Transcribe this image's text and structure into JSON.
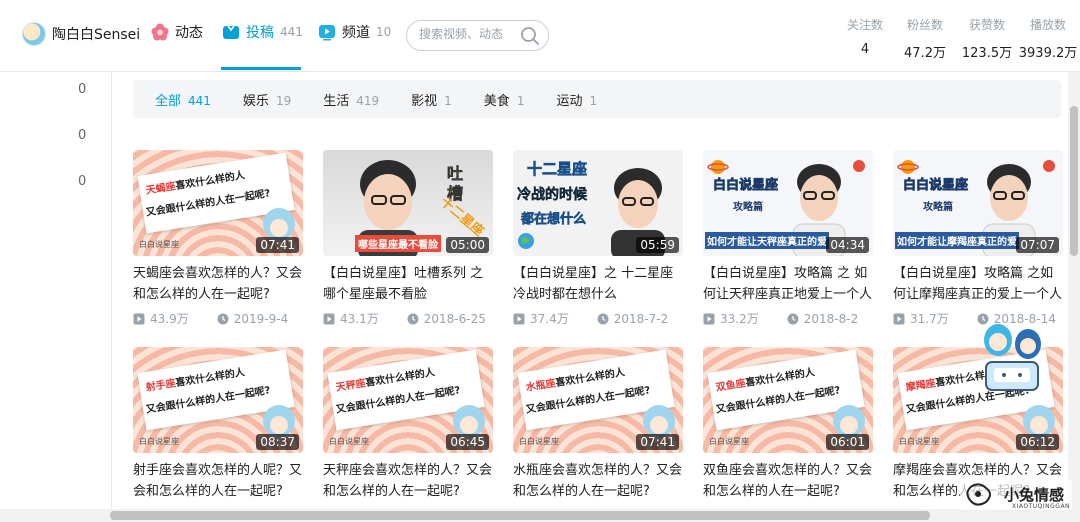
{
  "user": {
    "name": "陶白白Sensei"
  },
  "nav": [
    {
      "label": "动态",
      "count": ""
    },
    {
      "label": "投稿",
      "count": "441"
    },
    {
      "label": "频道",
      "count": "10"
    }
  ],
  "search": {
    "placeholder": "搜索视频、动态"
  },
  "stats": [
    {
      "label": "关注数",
      "value": "4"
    },
    {
      "label": "粉丝数",
      "value": "47.2万"
    },
    {
      "label": "获赞数",
      "value": "123.5万"
    },
    {
      "label": "播放数",
      "value": "3939.2万"
    }
  ],
  "left_counts": [
    "0",
    "0",
    "0"
  ],
  "filters": [
    {
      "label": "全部",
      "count": "441"
    },
    {
      "label": "娱乐",
      "count": "19"
    },
    {
      "label": "生活",
      "count": "419"
    },
    {
      "label": "影视",
      "count": "1"
    },
    {
      "label": "美食",
      "count": "1"
    },
    {
      "label": "运动",
      "count": "1"
    }
  ],
  "videos": [
    {
      "title": "天蝎座会喜欢怎样的人？又会和怎么样的人在一起呢?",
      "duration": "07:41",
      "plays": "43.9万",
      "date": "2019-9-4",
      "thumb": {
        "style": "quote",
        "hl": "天蝎座",
        "l1": "喜欢什么样的人",
        "l2": "又会跟什么样的人在一起呢?",
        "note": "白白说星座"
      }
    },
    {
      "title": "【白白说星座】吐槽系列 之 哪个星座最不看脸",
      "duration": "05:00",
      "plays": "43.1万",
      "date": "2018-6-25",
      "thumb": {
        "style": "face",
        "t1": "吐",
        "t2": "槽",
        "t3": "十二星座",
        "t4": "哪些星座最不看脸"
      }
    },
    {
      "title": "【白白说星座】之 十二星座冷战时都在想什么",
      "duration": "05:59",
      "plays": "37.4万",
      "date": "2018-7-2",
      "thumb": {
        "style": "cold",
        "t1": "十二星座",
        "t2": "冷战的时候",
        "t3": "都在想什么"
      }
    },
    {
      "title": "【白白说星座】攻略篇 之 如何让天秤座真正地爱上一个人",
      "duration": "04:34",
      "plays": "33.2万",
      "date": "2018-8-2",
      "thumb": {
        "style": "space",
        "t1": "白白说星座",
        "t2": "攻略篇",
        "t3": "如何才能让天秤座真正的爱"
      }
    },
    {
      "title": "【白白说星座】攻略篇 之如何让摩羯座真正的爱上一个人",
      "duration": "07:07",
      "plays": "31.7万",
      "date": "2018-8-14",
      "thumb": {
        "style": "space",
        "t1": "白白说星座",
        "t2": "攻略篇",
        "t3": "如何才能让摩羯座真正的爱"
      }
    },
    {
      "title": "射手座会喜欢怎样的人呢？又会和怎么样的人在一起呢?",
      "duration": "08:37",
      "plays": "",
      "date": "",
      "thumb": {
        "style": "quote",
        "hl": "射手座",
        "l1": "喜欢什么样的人",
        "l2": "又会跟什么样的人在一起呢?",
        "note": "白白说星座"
      }
    },
    {
      "title": "天秤座会喜欢怎样的人？又会和怎么样的人在一起呢?",
      "duration": "06:45",
      "plays": "",
      "date": "",
      "thumb": {
        "style": "quote",
        "hl": "天秤座",
        "l1": "喜欢什么样的人",
        "l2": "又会跟什么样的人在一起呢?",
        "note": "白白说星座"
      }
    },
    {
      "title": "水瓶座会喜欢怎样的人？又会和怎么样的人在一起呢?",
      "duration": "07:41",
      "plays": "",
      "date": "",
      "thumb": {
        "style": "quote",
        "hl": "水瓶座",
        "l1": "喜欢什么样的人",
        "l2": "又会跟什么样的人在一起呢?",
        "note": "白白说星座"
      }
    },
    {
      "title": "双鱼座会喜欢怎样的人？又会和怎么样的人在一起呢?",
      "duration": "06:01",
      "plays": "",
      "date": "",
      "thumb": {
        "style": "quote",
        "hl": "双鱼座",
        "l1": "喜欢什么样的人",
        "l2": "又会跟什么样的人在一起呢?",
        "note": "白白说星座"
      }
    },
    {
      "title": "摩羯座会喜欢怎样的人？又会和怎么样的人在一起呢?",
      "duration": "06:12",
      "plays": "",
      "date": "",
      "thumb": {
        "style": "quote",
        "hl": "摩羯座",
        "l1": "喜欢什么样的人",
        "l2": "又会跟什么样的人在一起呢?",
        "note": "白白说星座"
      }
    }
  ],
  "watermark": {
    "text": "小兔情感",
    "sub": "XIAOTUQINGGAN"
  },
  "colors": {
    "accent": "#00a1d6",
    "muted": "#99a2aa",
    "filter_bg": "#f4f5f7"
  }
}
